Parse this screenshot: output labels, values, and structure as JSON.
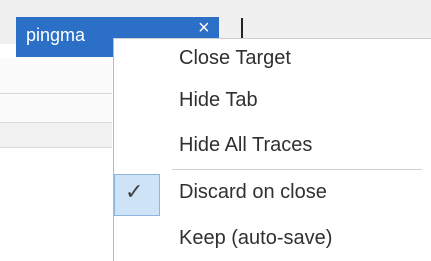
{
  "tab": {
    "label": "pingma",
    "close_icon": "×"
  },
  "context_menu": {
    "items": [
      {
        "label": "Close Target"
      },
      {
        "label": "Hide Tab"
      },
      {
        "label": "Hide All Traces"
      },
      {
        "label": "Discard on close",
        "checked": true
      },
      {
        "label": "Keep (auto-save)",
        "checked": false
      }
    ],
    "check_glyph": "✓"
  },
  "colors": {
    "tab_background": "#2b6fc6",
    "checked_highlight": "#cfe3f6"
  }
}
